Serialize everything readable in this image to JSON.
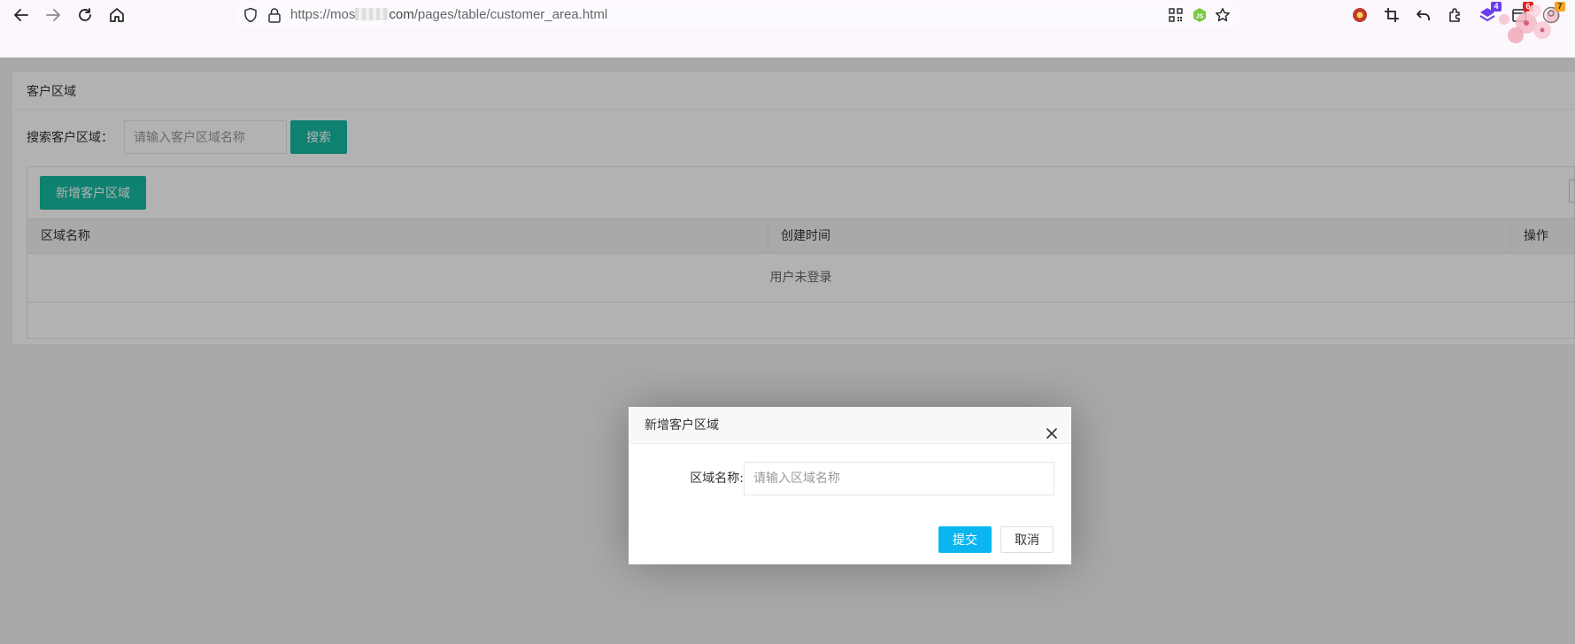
{
  "browser": {
    "url_prefix": "https://mos",
    "url_domain_suffix": "com",
    "url_path": "/pages/table/customer_area.html",
    "extensions": [
      {
        "name": "qr-code-icon"
      },
      {
        "name": "js-extension-icon",
        "color": "#7ac943"
      },
      {
        "name": "bookmark-star-icon"
      },
      {
        "name": "profile-extension-icon",
        "color": "#c0392b"
      },
      {
        "name": "crop-icon"
      },
      {
        "name": "undo-icon"
      },
      {
        "name": "puzzle-extensions-icon"
      },
      {
        "name": "layers-extension-icon",
        "color": "#6a3df0",
        "badge": "4",
        "badge_color": "#6a3df0"
      },
      {
        "name": "calendar-extension-icon",
        "badge": "6",
        "badge_color": "#e02020"
      },
      {
        "name": "account-avatar-icon",
        "badge": "7",
        "badge_color": "#f5a623"
      }
    ]
  },
  "page": {
    "card_title": "客户区域",
    "search_label": "搜索客户区域：",
    "search_placeholder": "请输入客户区域名称",
    "search_button": "搜索",
    "add_button": "新增客户区域",
    "table": {
      "columns": [
        "区域名称",
        "创建时间",
        "操作"
      ],
      "empty_message": "用户未登录"
    }
  },
  "modal": {
    "title": "新增客户区域",
    "field_label": "区域名称:",
    "field_placeholder": "请输入区域名称",
    "submit_label": "提交",
    "cancel_label": "取消"
  },
  "colors": {
    "primary_green": "#16b9a1",
    "submit_blue": "#09b6f0",
    "overlay": "rgba(0,0,0,0.30)"
  }
}
